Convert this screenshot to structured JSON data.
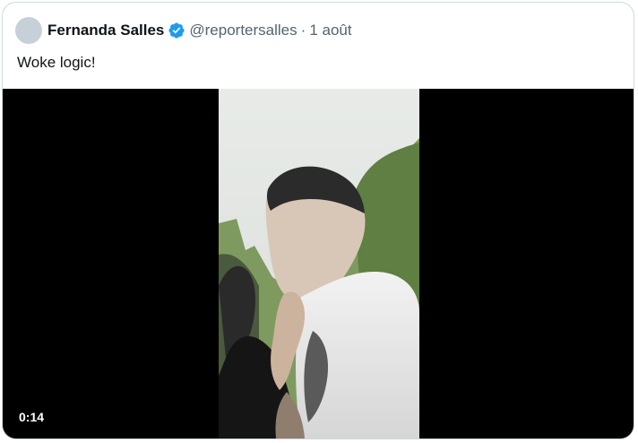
{
  "tweet": {
    "display_name": "Fernanda Salles",
    "handle": "@reportersalles",
    "separator": "·",
    "date": "1 août",
    "text": "Woke logic!"
  },
  "media": {
    "type": "video",
    "duration_label": "0:14"
  },
  "colors": {
    "border": "#cfd9de",
    "verified_blue": "#1d9bf0",
    "secondary_text": "#536471",
    "primary_text": "#0f1419",
    "media_background": "#000000"
  },
  "icons": {
    "verified": "verified-badge-icon",
    "avatar": "avatar"
  }
}
